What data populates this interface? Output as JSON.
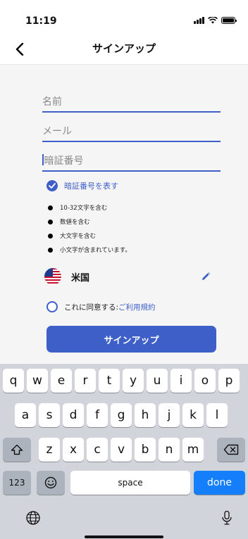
{
  "status_bar": {
    "time": "11:19"
  },
  "nav": {
    "title": "サインアップ"
  },
  "form": {
    "name_placeholder": "名前",
    "email_placeholder": "メール",
    "password_placeholder": "暗証番号",
    "show_password_label": "暗証番号を表す",
    "password_rules": [
      "10-32文字を含む",
      "数値を含む",
      "大文字を含む",
      "小文字が含まれています。"
    ],
    "country": "米国",
    "agree_prefix": "これに同意する: ",
    "agree_link": "ご利用規約",
    "signup_button": "サインアップ"
  },
  "keyboard": {
    "row1": [
      "q",
      "w",
      "e",
      "r",
      "t",
      "y",
      "u",
      "i",
      "o",
      "p"
    ],
    "row2": [
      "a",
      "s",
      "d",
      "f",
      "g",
      "h",
      "j",
      "k",
      "l"
    ],
    "row3": [
      "z",
      "x",
      "c",
      "v",
      "b",
      "n",
      "m"
    ],
    "numbers_key": "123",
    "space_key": "space",
    "done_key": "done"
  },
  "colors": {
    "accent": "#3f5fc8",
    "keyboard_bg": "#d1d4da",
    "done_key": "#147efb"
  },
  "icons": [
    "back-chevron-icon",
    "signal-icon",
    "wifi-icon",
    "battery-icon",
    "check-icon",
    "us-flag-icon",
    "pencil-icon",
    "shift-icon",
    "backspace-icon",
    "emoji-icon",
    "globe-icon",
    "microphone-icon"
  ]
}
